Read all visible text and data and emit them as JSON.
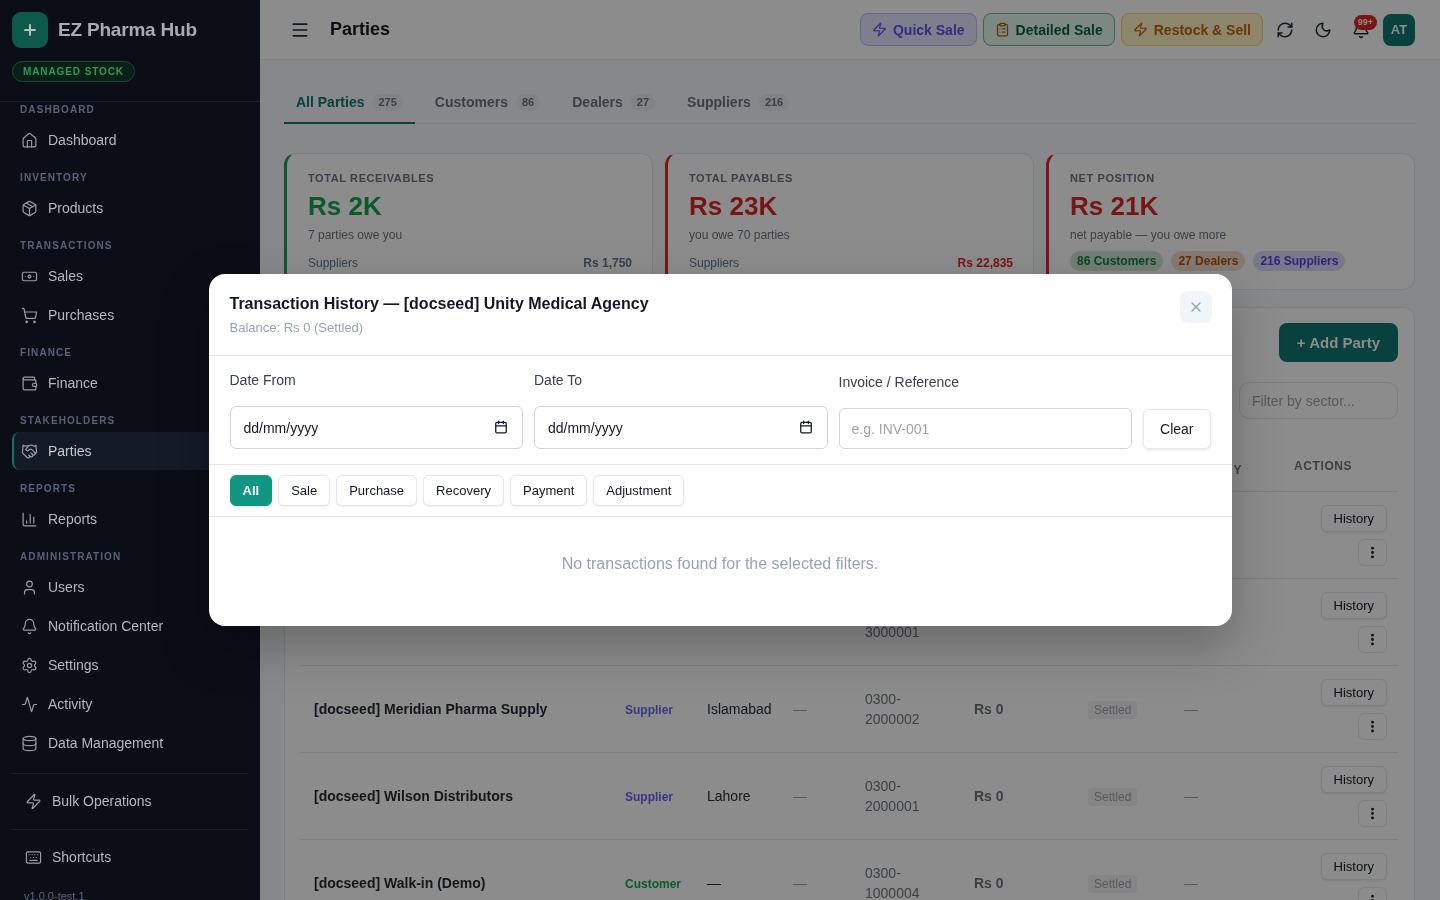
{
  "sidebar": {
    "app_name": "EZ Pharma Hub",
    "badge": "MANAGED STOCK",
    "sections": [
      {
        "label": "DASHBOARD",
        "items": [
          {
            "label": "Dashboard",
            "selected": false
          }
        ]
      },
      {
        "label": "INVENTORY",
        "items": [
          {
            "label": "Products",
            "selected": false
          }
        ]
      },
      {
        "label": "TRANSACTIONS",
        "items": [
          {
            "label": "Sales",
            "selected": false
          },
          {
            "label": "Purchases",
            "selected": false
          }
        ]
      },
      {
        "label": "FINANCE",
        "items": [
          {
            "label": "Finance",
            "selected": false
          }
        ]
      },
      {
        "label": "STAKEHOLDERS",
        "items": [
          {
            "label": "Parties",
            "selected": true
          }
        ]
      },
      {
        "label": "REPORTS",
        "items": [
          {
            "label": "Reports",
            "selected": false
          }
        ]
      },
      {
        "label": "ADMINISTRATION",
        "items": [
          {
            "label": "Users",
            "selected": false
          },
          {
            "label": "Notification Center",
            "selected": false
          },
          {
            "label": "Settings",
            "selected": false
          },
          {
            "label": "Activity",
            "selected": false
          },
          {
            "label": "Data Management",
            "selected": false
          }
        ]
      }
    ],
    "tools": [
      {
        "label": "Bulk Operations"
      },
      {
        "label": "Shortcuts"
      }
    ],
    "version": "v1.0.0-test.1"
  },
  "header": {
    "title": "Parties",
    "quick_actions": [
      {
        "label": "Quick Sale",
        "kind": "quick"
      },
      {
        "label": "Detailed Sale",
        "kind": "detailed"
      },
      {
        "label": "Restock & Sell",
        "kind": "restock"
      }
    ],
    "notification_count": "99+",
    "avatar": "AT"
  },
  "tabs": [
    {
      "label": "All Parties",
      "count": "275",
      "selected": true
    },
    {
      "label": "Customers",
      "count": "86",
      "selected": false
    },
    {
      "label": "Dealers",
      "count": "27",
      "selected": false
    },
    {
      "label": "Suppliers",
      "count": "216",
      "selected": false
    }
  ],
  "summary_cards": [
    {
      "label": "TOTAL RECEIVABLES",
      "value": "Rs 2K",
      "note": "7 parties owe you",
      "color": "#0c5a29",
      "breakdown": {
        "label": "Suppliers",
        "value": "Rs 1,750",
        "highlighted": false
      }
    },
    {
      "label": "TOTAL PAYABLES",
      "value": "Rs 23K",
      "note": "you owe 70 parties",
      "color": "#791515",
      "breakdown": {
        "label": "Suppliers",
        "value": "Rs 22,835",
        "highlighted": true
      }
    },
    {
      "label": "NET POSITION",
      "value": "Rs 21K",
      "note": "net payable — you owe more",
      "color": "#791515",
      "chips": [
        {
          "label": "86 Customers",
          "color": "#0c4622"
        },
        {
          "label": "27 Dealers",
          "color": "#632e05"
        },
        {
          "label": "216 Suppliers",
          "color": "#2b277e"
        }
      ]
    }
  ],
  "parties_table": {
    "add_button": "+ Add Party",
    "sector_filter": {
      "placeholder": "Filter by sector..."
    },
    "columns": [
      "Y",
      "ACTIONS"
    ],
    "rows": [
      {
        "action": "History"
      },
      {
        "phone": "3000001",
        "action": "History"
      },
      {
        "name": "[docseed] Meridian Pharma Supply",
        "type": {
          "label": "Supplier",
          "color": "#363885"
        },
        "city": "Islamabad",
        "column_4": "—",
        "phone": "0300-2000002",
        "balance": "Rs 0",
        "status": "Settled",
        "column_8": "—",
        "action": "History"
      },
      {
        "name": "[docseed] Wilson Distributors",
        "type": {
          "label": "Supplier",
          "color": "#363885"
        },
        "city": "Lahore",
        "column_4": "—",
        "phone": "0300-2000001",
        "balance": "Rs 0",
        "status": "Settled",
        "column_8": "—",
        "action": "History"
      },
      {
        "name": "[docseed] Walk-in (Demo)",
        "type": {
          "label": "Customer",
          "color": "#0c5a29"
        },
        "city": "—",
        "column_4": "—",
        "phone": "0300-1000004",
        "balance": "Rs 0",
        "status": "Settled",
        "column_8": "—",
        "action": "History"
      }
    ]
  },
  "modal": {
    "title": "Transaction History — [docseed] Unity Medical Agency",
    "subtitle": "Balance: Rs 0 (Settled)",
    "filters": [
      {
        "label": "Date From",
        "kind": "date",
        "placeholder": "dd/mm/yyyy"
      },
      {
        "label": "Date To",
        "kind": "date",
        "placeholder": "dd/mm/yyyy"
      },
      {
        "label": "Invoice / Reference",
        "kind": "text",
        "placeholder": "e.g. INV-001"
      }
    ],
    "clear_button": "Clear",
    "type_filters": [
      {
        "label": "All",
        "selected": true
      },
      {
        "label": "Sale",
        "selected": false
      },
      {
        "label": "Purchase",
        "selected": false
      },
      {
        "label": "Recovery",
        "selected": false
      },
      {
        "label": "Payment",
        "selected": false
      },
      {
        "label": "Adjustment",
        "selected": false
      }
    ],
    "empty_message": "No transactions found for the selected filters."
  }
}
